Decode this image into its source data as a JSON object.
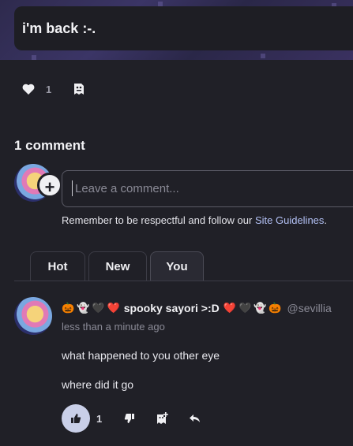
{
  "post": {
    "title": "i'm back :-.",
    "like_count": "1"
  },
  "comments_section": {
    "header": "1 comment",
    "input_placeholder": "Leave a comment...",
    "guidelines_prefix": "Remember to be respectful and follow our ",
    "guidelines_link": "Site Guidelines",
    "guidelines_suffix": ".",
    "tabs": [
      {
        "label": "Hot"
      },
      {
        "label": "New"
      },
      {
        "label": "You"
      }
    ]
  },
  "comment": {
    "emoji_prefix": [
      "🎃",
      "👻",
      "🖤",
      "❤️"
    ],
    "author": "spooky sayori >:D",
    "emoji_suffix": [
      "❤️",
      "🖤",
      "👻",
      "🎃"
    ],
    "handle": "@sevillia",
    "time": "less than a minute ago",
    "lines": [
      "what happened to you other eye",
      "where did it go"
    ],
    "upvote_count": "1"
  }
}
